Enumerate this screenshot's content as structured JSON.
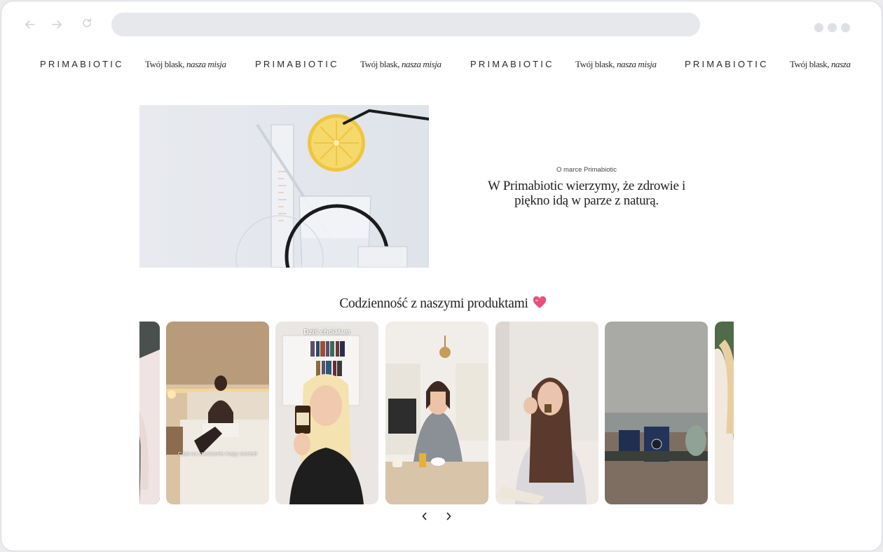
{
  "browser": {
    "back_icon": "arrow-left-icon",
    "forward_icon": "arrow-right-icon",
    "reload_icon": "reload-icon",
    "menu_icon": "more-dots-icon"
  },
  "marquee": {
    "brand": "PRIMABIOTIC",
    "tagline_prefix": "Twój blask, ",
    "tagline_italic": "nasza misja"
  },
  "about": {
    "kicker": "O marce Primabiotic",
    "headline": "W Primabiotic wierzymy, że zdrowie i piękno idą w parze z naturą."
  },
  "products_section": {
    "title": "Codzienność z naszymi produktami",
    "heart_icon": "pink-heart-icon",
    "cards": [
      {
        "caption": ""
      },
      {
        "caption": "Czas na stworzenie mapy marzeń"
      },
      {
        "caption": "Dziś chciałam"
      },
      {
        "caption": ""
      },
      {
        "caption": ""
      },
      {
        "caption": ""
      },
      {
        "caption": ""
      }
    ],
    "prev_icon": "chevron-left-icon",
    "next_icon": "chevron-right-icon"
  },
  "colors": {
    "accent_heart": "#e8507c",
    "text": "#222222",
    "urlbar": "#e6e8ec"
  }
}
